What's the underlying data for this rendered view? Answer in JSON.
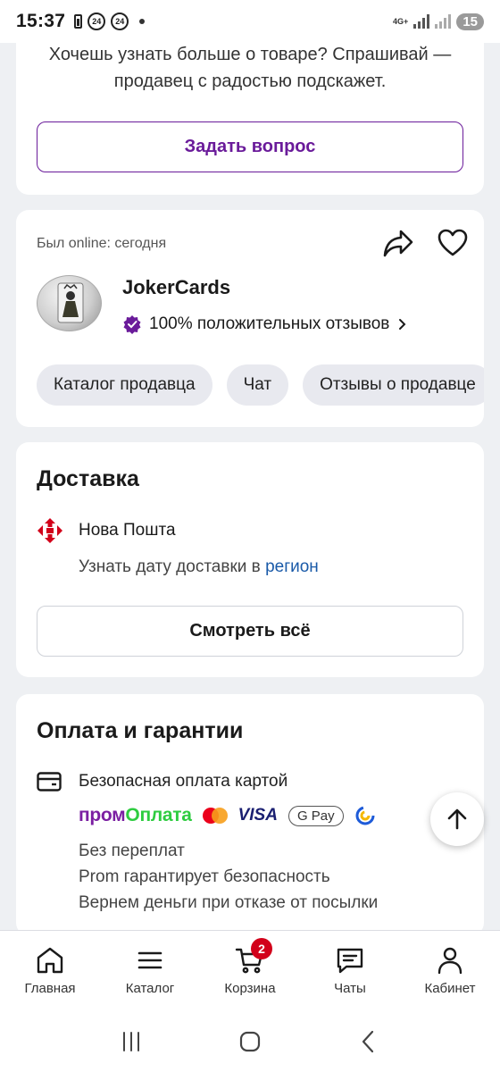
{
  "status_bar": {
    "time": "15:37",
    "badge_a": "24",
    "badge_b": "24",
    "network": "4G+",
    "battery": "15"
  },
  "question": {
    "text": "Хочешь узнать больше о товаре? Спрашивай — продавец с радостью подскажет.",
    "button": "Задать вопрос"
  },
  "seller": {
    "online": "Был online: сегодня",
    "name": "JokerCards",
    "rating": "100% положительных отзывов",
    "chips": [
      "Каталог продавца",
      "Чат",
      "Отзывы о продавце"
    ]
  },
  "delivery": {
    "title": "Доставка",
    "carrier": "Нова Пошта",
    "date_prefix": "Узнать дату доставки в",
    "date_link": "регион",
    "view_all": "Смотреть всё"
  },
  "payment": {
    "title": "Оплата и гарантии",
    "secure": "Безопасная оплата картой",
    "prom_part1": "пром",
    "prom_part2": "Оплата",
    "visa": "VISA",
    "gpay": "G Pay",
    "lines": [
      "Без переплат",
      "Prom гарантирует безопасность",
      "Вернем деньги при отказе от посылки"
    ]
  },
  "bottom_nav": {
    "items": [
      {
        "label": "Главная",
        "icon": "home-icon"
      },
      {
        "label": "Каталог",
        "icon": "menu-icon"
      },
      {
        "label": "Корзина",
        "icon": "cart-icon",
        "badge": "2"
      },
      {
        "label": "Чаты",
        "icon": "chat-icon"
      },
      {
        "label": "Кабинет",
        "icon": "user-icon"
      }
    ]
  },
  "colors": {
    "accent": "#6a1b9a",
    "link": "#1a5aa8",
    "badge": "#d2001a",
    "background": "#eef0f3"
  }
}
